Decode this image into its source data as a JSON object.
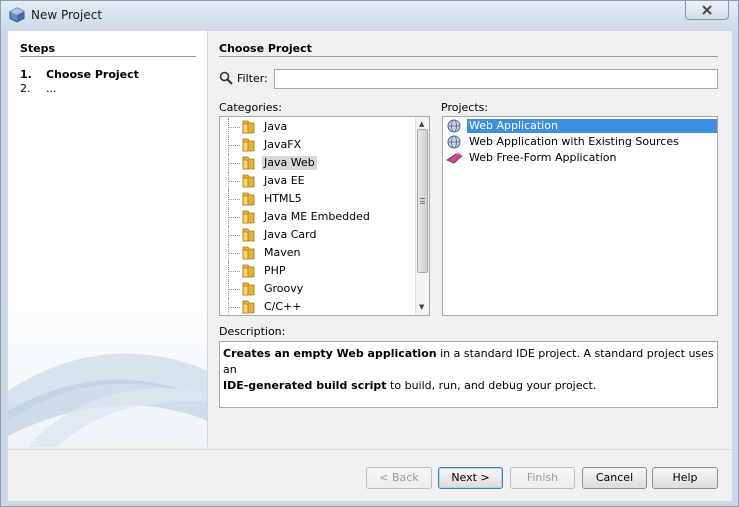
{
  "window": {
    "title": "New Project",
    "close_icon": "close-icon"
  },
  "steps": {
    "title": "Steps",
    "items": [
      {
        "num": "1.",
        "label": "Choose Project"
      },
      {
        "num": "2.",
        "label": "..."
      }
    ]
  },
  "main": {
    "title": "Choose Project",
    "filter": {
      "label": "Filter:",
      "value": "",
      "placeholder": ""
    },
    "categories_label": "Categories:",
    "projects_label": "Projects:",
    "categories": [
      "Java",
      "JavaFX",
      "Java Web",
      "Java EE",
      "HTML5",
      "Java ME Embedded",
      "Java Card",
      "Maven",
      "PHP",
      "Groovy",
      "C/C++"
    ],
    "selected_category": "Java Web",
    "projects": [
      {
        "label": "Web Application",
        "icon": "globe-icon"
      },
      {
        "label": "Web Application with Existing Sources",
        "icon": "globe-icon"
      },
      {
        "label": "Web Free-Form Application",
        "icon": "free-form-icon"
      }
    ],
    "selected_project": "Web Application",
    "description": {
      "label": "Description:",
      "bold1": "Creates an empty Web application",
      "text1": " in a standard IDE project. A standard project uses an ",
      "bold2": "IDE-generated build script",
      "text2": " to build, run, and debug your project."
    }
  },
  "buttons": {
    "back": "< Back",
    "next": "Next >",
    "finish": "Finish",
    "cancel": "Cancel",
    "help": "Help"
  },
  "colors": {
    "selection": "#3d8fe0",
    "folder": "#e8b13a",
    "window_frame": "#cfd9e6"
  }
}
